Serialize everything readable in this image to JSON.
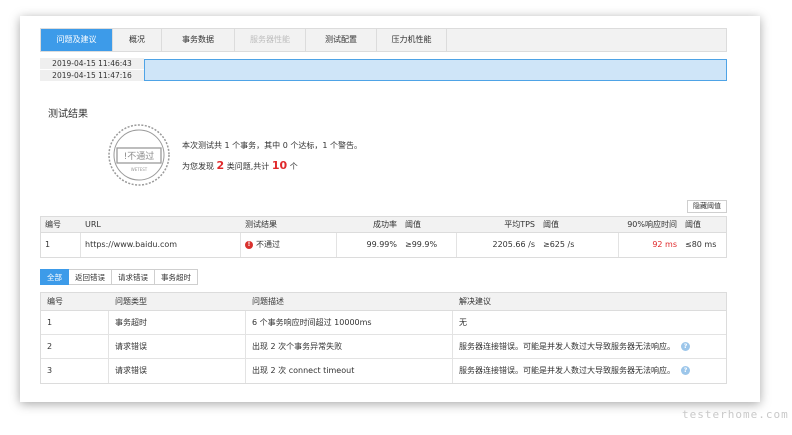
{
  "tabs": [
    {
      "label": "问题及建议",
      "state": "active"
    },
    {
      "label": "概况",
      "state": "normal"
    },
    {
      "label": "事务数据",
      "state": "normal"
    },
    {
      "label": "服务器性能",
      "state": "disabled"
    },
    {
      "label": "测试配置",
      "state": "normal"
    },
    {
      "label": "压力机性能",
      "state": "normal"
    }
  ],
  "times": [
    "2019-04-15 11:46:43",
    "2019-04-15 11:47:16"
  ],
  "section_title": "测试结果",
  "stamp": {
    "text": "!不通过",
    "small": "WETEST"
  },
  "summary": {
    "line1": "本次测试共 1 个事务，其中 0 个达标，1 个警告。",
    "line2_prefix": "为您发现",
    "issue_types": "2",
    "line2_mid": "类问题,共计",
    "issue_total": "10",
    "line2_suffix": "个"
  },
  "hide_threshold_button": "隐藏阈值",
  "result_table": {
    "headers": [
      "编号",
      "URL",
      "测试结果",
      "成功率",
      "阈值",
      "平均TPS",
      "阈值",
      "90%响应时间",
      "阈值"
    ],
    "row": {
      "id": "1",
      "url": "https://www.baidu.com",
      "result": "不通过",
      "success_rate": "99.99%",
      "success_threshold": "≥99.9%",
      "tps": "2205.66 /s",
      "tps_threshold": "≥625 /s",
      "rt90": "92 ms",
      "rt90_threshold": "≤80 ms"
    }
  },
  "sub_tabs": [
    "全部",
    "返回错误",
    "请求错误",
    "事务超时"
  ],
  "issue_table": {
    "headers": [
      "编号",
      "问题类型",
      "问题描述",
      "解决建议"
    ],
    "rows": [
      {
        "id": "1",
        "type": "事务超时",
        "desc": "6 个事务响应时间超过 10000ms",
        "advice": "无",
        "help": false
      },
      {
        "id": "2",
        "type": "请求错误",
        "desc": "出现 2 次个事务异常失败",
        "advice": "服务器连接错误。可能是并发人数过大导致服务器无法响应。",
        "help": true
      },
      {
        "id": "3",
        "type": "请求错误",
        "desc": "出现 2 次 connect timeout",
        "advice": "服务器连接错误。可能是并发人数过大导致服务器无法响应。",
        "help": true
      }
    ]
  },
  "watermark": "testerhome.com",
  "colors": {
    "accent": "#3d9be9",
    "error": "#e0292b"
  }
}
